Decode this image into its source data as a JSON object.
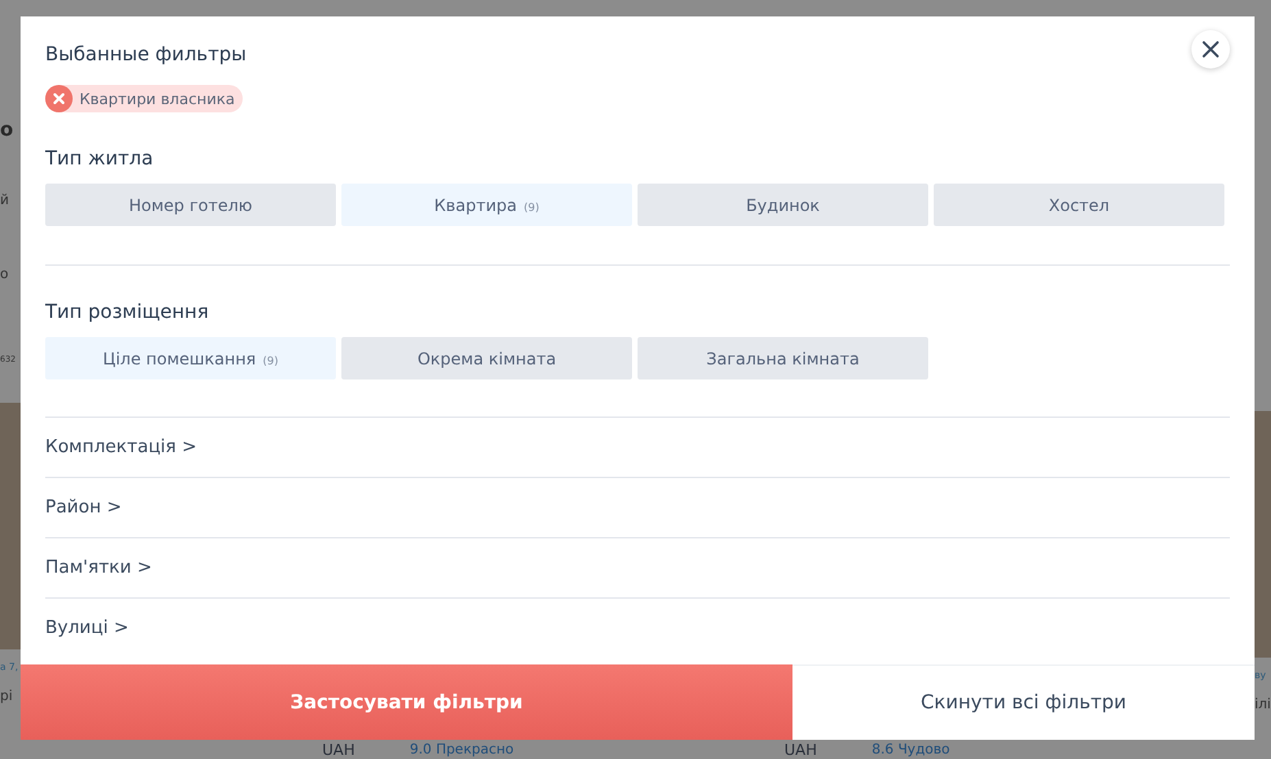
{
  "background": {
    "left_fragments": [
      "о",
      "й",
      "о",
      "632",
      "а 7,",
      "рі"
    ],
    "right_fragments": [
      "ву",
      "ілі"
    ],
    "prices": [
      {
        "currency": "UAH",
        "rating": "9.0 Прекрасно"
      },
      {
        "currency": "UAH",
        "rating": "8.6 Чудово"
      }
    ]
  },
  "modal": {
    "selected_filters": {
      "title": "Выбанные фильтры",
      "chips": [
        {
          "label": "Квартири власника"
        }
      ]
    },
    "sections": [
      {
        "title": "Тип житла",
        "options": [
          {
            "label": "Номер готелю",
            "selected": false
          },
          {
            "label": "Квартира",
            "count": "(9)",
            "selected": true
          },
          {
            "label": "Будинок",
            "selected": false
          },
          {
            "label": "Хостел",
            "selected": false
          }
        ]
      },
      {
        "title": "Тип розміщення",
        "options": [
          {
            "label": "Ціле помешкання",
            "count": "(9)",
            "selected": true
          },
          {
            "label": "Окрема кімната",
            "selected": false
          },
          {
            "label": "Загальна кімната",
            "selected": false
          }
        ]
      }
    ],
    "links": [
      "Комплектація >",
      "Район >",
      "Пам'ятки >",
      "Вулиці >"
    ],
    "footer": {
      "apply": "Застосувати фільтри",
      "reset": "Скинути всі фільтри"
    }
  }
}
